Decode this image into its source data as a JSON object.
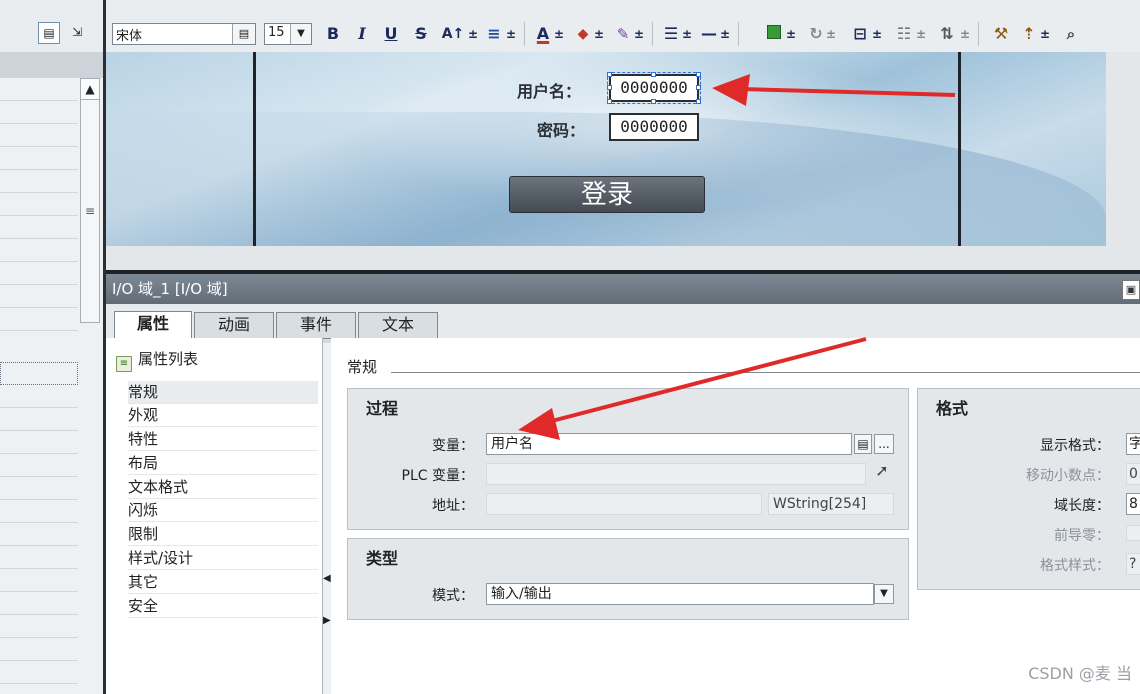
{
  "toolbar": {
    "font_name": "宋体",
    "font_size": "15",
    "bold": "B",
    "italic": "I",
    "underline": "U",
    "strike": "S",
    "font_grow": "A↑",
    "align": "≡",
    "font_color": "A",
    "fill_color": "◆",
    "line_color": "✎",
    "line_style": "☰",
    "line_width": "—",
    "dropdown": "±"
  },
  "screen": {
    "username_label": "用户名：",
    "username_value": "0000000",
    "password_label": "密码：",
    "password_value": "0000000",
    "login_button": "登录"
  },
  "inspector": {
    "title": "I/O 域_1 [I/O 域]",
    "tabs": [
      "属性",
      "动画",
      "事件",
      "文本"
    ],
    "property_list_title": "属性列表",
    "property_items": [
      "常规",
      "外观",
      "特性",
      "布局",
      "文本格式",
      "闪烁",
      "限制",
      "样式/设计",
      "其它",
      "安全"
    ],
    "general_title": "常规",
    "process": {
      "title": "过程",
      "variable_label": "变量：",
      "variable_value": "用户名",
      "plc_variable_label": "PLC 变量：",
      "plc_variable_value": "",
      "address_label": "地址：",
      "address_value": "",
      "type_value": "WString[254]",
      "more_button": "..."
    },
    "type_group": {
      "title": "类型",
      "mode_label": "模式：",
      "mode_value": "输入/输出"
    },
    "format": {
      "title": "格式",
      "display_format_label": "显示格式：",
      "display_format_value": "字",
      "move_decimal_label": "移动小数点：",
      "move_decimal_value": "0",
      "field_length_label": "域长度：",
      "field_length_value": "8",
      "leading_zero_label": "前导零：",
      "format_style_label": "格式样式：",
      "format_style_value": "?"
    }
  },
  "watermark": "CSDN @麦 当"
}
